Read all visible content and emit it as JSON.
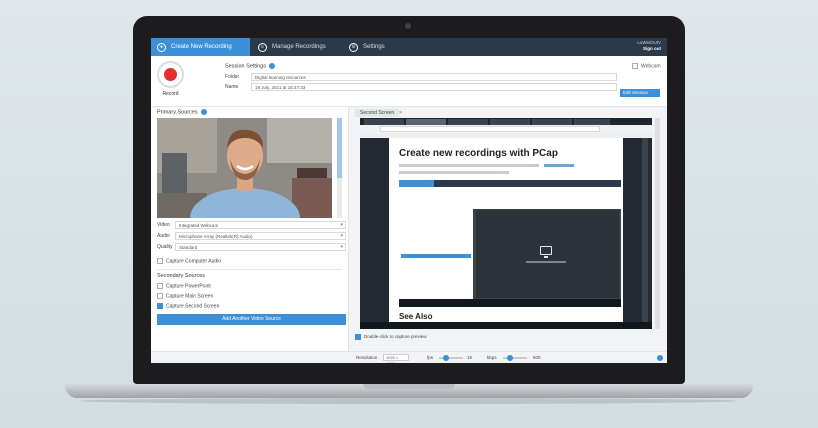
{
  "nav": {
    "tabs": [
      {
        "label": "Create New Recording",
        "icon": "record-icon"
      },
      {
        "label": "Manage Recordings",
        "icon": "list-icon"
      },
      {
        "label": "Settings",
        "icon": "gear-icon"
      }
    ],
    "user_name": "LuWeiOUIV",
    "sign_out": "Sign out"
  },
  "record": {
    "label": "Record"
  },
  "session": {
    "title": "Session Settings",
    "folder_label": "Folder",
    "folder_value": "Digital learning resources",
    "name_label": "Name",
    "name_value": "19 July, 2021 at 15:47:33",
    "edit_button": "Edit Session",
    "webcam_label": "Webcam"
  },
  "primary": {
    "title": "Primary Sources",
    "video_label": "Video",
    "video_value": "Integrated Webcam",
    "audio_label": "Audio",
    "audio_value": "Microphone Array (Realtek(R) Audio)",
    "quality_label": "Quality",
    "quality_value": "Standard",
    "capture_audio": "Capture Computer Audio"
  },
  "secondary": {
    "title": "Secondary Sources",
    "items": [
      {
        "label": "Capture PowerPoint",
        "checked": false
      },
      {
        "label": "Capture Main Screen",
        "checked": false
      },
      {
        "label": "Capture Second Screen",
        "checked": true
      }
    ],
    "add_button": "Add Another Video Source"
  },
  "second_screen": {
    "tab_label": "Second Screen",
    "close": "×",
    "doc_title": "Create new recordings with PCap",
    "see_also": "See Also",
    "double_click": "Double-click to capture preview"
  },
  "bottom": {
    "resolution_label": "Resolution",
    "resolution_value": "1920 × 1080",
    "fps_label": "fps",
    "fps_value": "15",
    "kbps_label": "kbps",
    "kbps_value": "500"
  },
  "colors": {
    "accent": "#3d8fd8",
    "nav_bg": "#2b3a4a",
    "record": "#e02f2f"
  }
}
